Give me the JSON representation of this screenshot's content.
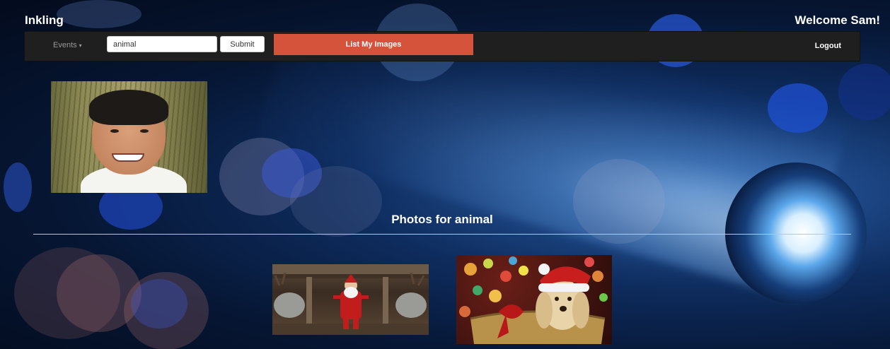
{
  "header": {
    "brand": "Inkling",
    "welcome": "Welcome Sam!"
  },
  "navbar": {
    "events_label": "Events",
    "search": {
      "value": "animal",
      "placeholder": ""
    },
    "submit_label": "Submit",
    "list_images_label": "List My Images",
    "logout_label": "Logout"
  },
  "main": {
    "section_title": "Photos for animal"
  },
  "colors": {
    "accent": "#d5533b",
    "navbar_bg": "#1f1f1f"
  }
}
